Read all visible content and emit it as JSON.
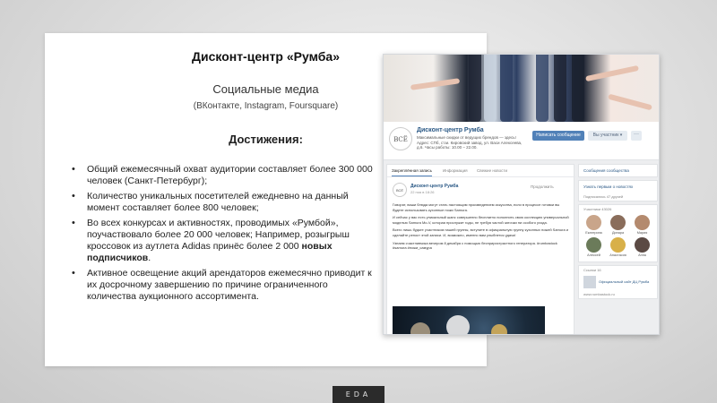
{
  "slide": {
    "title": "Дисконт-центр «Румба»",
    "subtitle": "Социальные медиа",
    "networks": "(ВКонтакте, Instagram, Foursquare)",
    "achievements_title": "Достижения:",
    "bullets": [
      {
        "text": "Общий ежемесячный охват аудитории составляет более 300 000 человек (Санкт-Петербург);"
      },
      {
        "text": "Количество уникальных посетителей ежедневно на данный момент составляет более 800 человек;"
      },
      {
        "text": "Во всех конкурсах и активностях, проводимых «Румбой», поучаствовало более 20 000 человек; Например, розыгрыш кроссовок из аутлета Adidas принёс более 2 000 ",
        "bold": "новых подписчиков",
        "tail": "."
      },
      {
        "text": "Активное освещение акций арендаторов ежемесячно приводит к их досрочному завершению по причине ограниченного количества аукционного ассортимента."
      }
    ],
    "footer_badge": "EDA"
  },
  "vk": {
    "logo_text": "ВСЁ",
    "group_name": "Дисконт-центр Румба",
    "group_desc": "Максимальные скидки от ведущих брендов — здесь! Адрес: СПб, ст.м. Кировский завод, ул. Васи Алексеева, д.6. Часы работы: 10.00 – 22.00.",
    "btn_message": "Написать сообщение",
    "btn_member": "Вы участник ▾",
    "btn_more": "···",
    "tabs": [
      "Закреплённая запись",
      "Информация",
      "Свежие новости"
    ],
    "post": {
      "avatar": "ВСЁ",
      "author": "Дисконт-центр Румба",
      "date": "22 ноя в 18:26",
      "pin_label": "Продолжить",
      "paragraphs": [
        "Говорят, ваши блюда могут стать настоящим произведением искусства, если в процессе готовки вы будете использовать кухонные ножи Samura.",
        "И сейчас у вас есть уникальный шанс совершенно бесплатно пополнить свою коллекцию универсальной моделью Samura Mo-V, которая прослужит годы, не требуя частой заточки ни особого ухода.",
        "Всего лишь будьте участником нашей группы, вступите в официальную группу кухонных ножей Samura и сделайте репост этой записи. И, возможно, именно вам улыбнется удача!",
        "Узнаем счастливчика вечером 8 декабря с помощью бесприристрастного генератора. #rumbastock #samura #ножи_самура"
      ]
    },
    "side": {
      "community_messages": "Сообщения сообщества",
      "notify": "Узнать первым о новостях",
      "friends_subscribed": "Подписались 47 друзей",
      "members_label": "Участники 43026",
      "members": [
        {
          "name": "Екатерина",
          "color": "#c9a58a"
        },
        {
          "name": "Динара",
          "color": "#8a6d5b"
        },
        {
          "name": "Мария",
          "color": "#b48a6e"
        },
        {
          "name": "Алексей",
          "color": "#6b7b5a"
        },
        {
          "name": "Анастасия",
          "color": "#d8b049"
        },
        {
          "name": "Анна",
          "color": "#5b4a44"
        }
      ],
      "links_label": "Ссылки 16",
      "link_title": "Официальный сайт ДЦ Румба",
      "link_url": "www.rumbastock.ru"
    }
  }
}
